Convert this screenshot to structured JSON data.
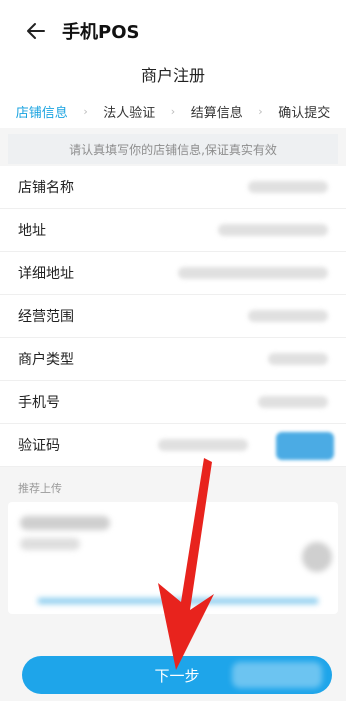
{
  "header": {
    "title": "手机POS"
  },
  "page": {
    "title": "商户注册"
  },
  "steps": [
    {
      "label": "店铺信息",
      "active": true
    },
    {
      "label": "法人验证",
      "active": false
    },
    {
      "label": "结算信息",
      "active": false
    },
    {
      "label": "确认提交",
      "active": false
    }
  ],
  "notice": "请认真填写你的店铺信息,保证真实有效",
  "form": {
    "rows": [
      {
        "label": "店铺名称"
      },
      {
        "label": "地址"
      },
      {
        "label": "详细地址"
      },
      {
        "label": "经营范围"
      },
      {
        "label": "商户类型"
      },
      {
        "label": "手机号"
      },
      {
        "label": "验证码"
      }
    ]
  },
  "section": {
    "recommend_upload": "推荐上传"
  },
  "footer": {
    "next_label": "下一步"
  },
  "colors": {
    "accent": "#1ea5ea",
    "annotation": "#e8231d"
  }
}
